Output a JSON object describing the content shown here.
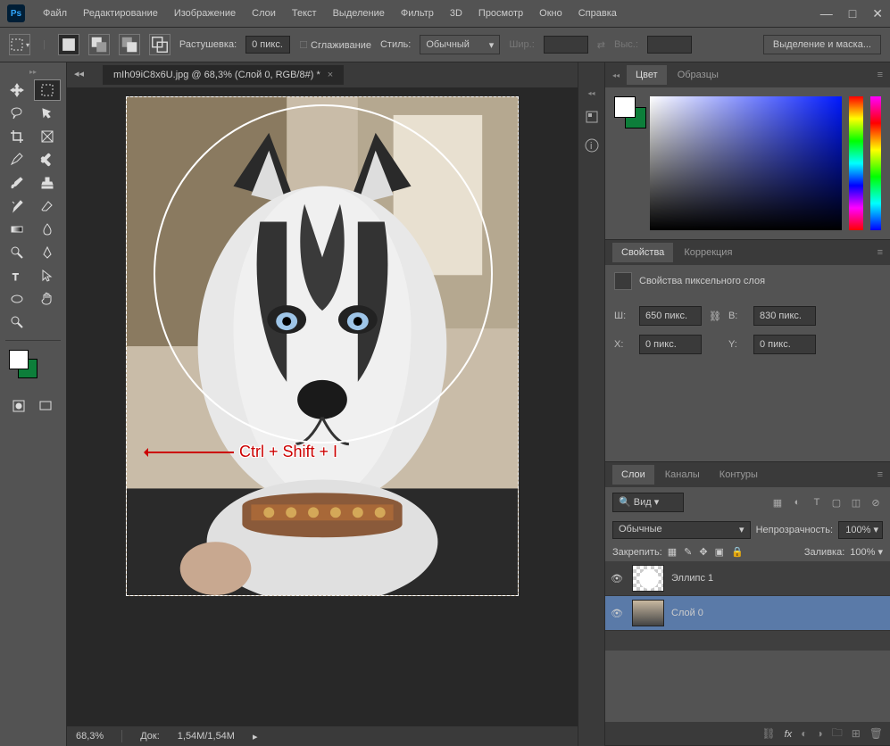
{
  "app": {
    "logo": "Ps"
  },
  "menu": [
    "Файл",
    "Редактирование",
    "Изображение",
    "Слои",
    "Текст",
    "Выделение",
    "Фильтр",
    "3D",
    "Просмотр",
    "Окно",
    "Справка"
  ],
  "options": {
    "feather_label": "Растушевка:",
    "feather_value": "0 пикс.",
    "antialias": "Сглаживание",
    "style_label": "Стиль:",
    "style_value": "Обычный",
    "width_label": "Шир.:",
    "height_label": "Выс.:",
    "mask_button": "Выделение и маска..."
  },
  "document": {
    "tab_title": "mIh09iC8x6U.jpg @ 68,3% (Слой 0, RGB/8#) *",
    "zoom": "68,3%",
    "dock_label": "Док:",
    "dock_value": "1,54M/1,54M",
    "annotation": "Ctrl + Shift + I"
  },
  "panels": {
    "color": {
      "tab1": "Цвет",
      "tab2": "Образцы"
    },
    "properties": {
      "tab1": "Свойства",
      "tab2": "Коррекция",
      "title": "Свойства пиксельного слоя",
      "w_label": "Ш:",
      "w_value": "650 пикс.",
      "h_label": "В:",
      "h_value": "830 пикс.",
      "x_label": "X:",
      "x_value": "0 пикс.",
      "y_label": "Y:",
      "y_value": "0 пикс."
    },
    "layers": {
      "tab1": "Слои",
      "tab2": "Каналы",
      "tab3": "Контуры",
      "search_placeholder": "Вид",
      "blend_mode": "Обычные",
      "opacity_label": "Непрозрачность:",
      "opacity_value": "100%",
      "lock_label": "Закрепить:",
      "fill_label": "Заливка:",
      "fill_value": "100%",
      "layer1": "Эллипс 1",
      "layer2": "Слой 0"
    }
  }
}
